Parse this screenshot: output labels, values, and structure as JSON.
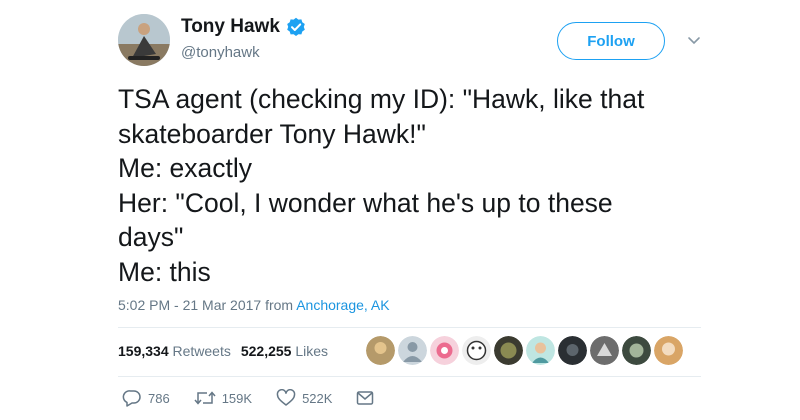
{
  "user": {
    "name": "Tony Hawk",
    "handle": "@tonyhawk",
    "follow_label": "Follow"
  },
  "tweet": {
    "lines": [
      "TSA agent (checking my ID): \"Hawk, like that",
      "skateboarder Tony Hawk!\"",
      "Me: exactly",
      "Her: \"Cool, I wonder what he's up to these",
      "days\"",
      "Me: this"
    ],
    "timestamp": "5:02 PM - 21 Mar 2017",
    "from_label": "from",
    "location": "Anchorage, AK"
  },
  "stats": {
    "retweets_count": "159,334",
    "retweets_label": "Retweets",
    "likes_count": "522,255",
    "likes_label": "Likes"
  },
  "actions": {
    "reply_count": "786",
    "retweet_count": "159K",
    "like_count": "522K"
  },
  "colors": {
    "accent": "#1da1f2",
    "link": "#1b95e0",
    "muted": "#657786",
    "text": "#14171a"
  }
}
